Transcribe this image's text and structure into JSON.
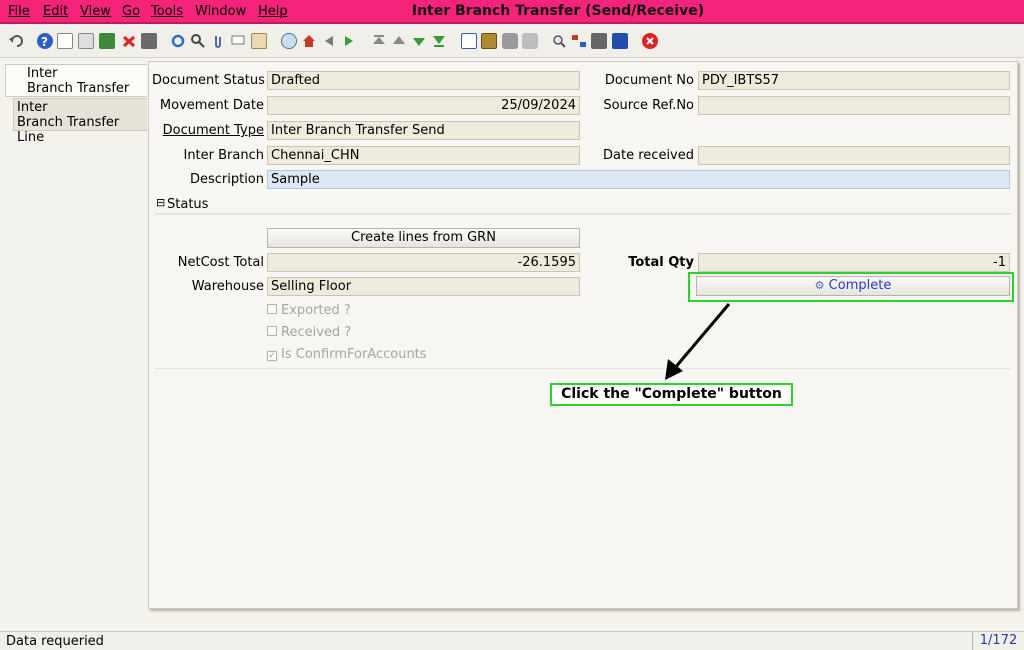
{
  "menu": {
    "file": "File",
    "edit": "Edit",
    "view": "View",
    "go": "Go",
    "tools": "Tools",
    "window": "Window",
    "help": "Help"
  },
  "window_title": "Inter Branch Transfer (Send/Receive)",
  "tabs": {
    "tab1_line1": "Inter",
    "tab1_line2": "Branch Transfer",
    "tab2_line1": "Inter",
    "tab2_line2": "Branch Transfer Line"
  },
  "form": {
    "document_status_label": "Document Status",
    "document_status": "Drafted",
    "document_no_label": "Document No",
    "document_no": "PDY_IBTS57",
    "movement_date_label": "Movement Date",
    "movement_date": "25/09/2024",
    "source_ref_label": "Source Ref.No",
    "source_ref": "",
    "document_type_label": "Document Type",
    "document_type": "Inter Branch Transfer Send",
    "inter_branch_label": "Inter Branch",
    "inter_branch": "Chennai_CHN",
    "date_received_label": "Date received",
    "date_received": "",
    "description_label": "Description",
    "description": "Sample"
  },
  "status_section": {
    "toggle": "⊟",
    "title": "Status",
    "create_lines_button": "Create lines from GRN",
    "netcost_total_label": "NetCost Total",
    "netcost_total": "-26.1595",
    "total_qty_label": "Total Qty",
    "total_qty": "-1",
    "warehouse_label": "Warehouse",
    "warehouse": "Selling Floor",
    "complete_button": "Complete",
    "exported_label": "Exported ?",
    "received_label": "Received ?",
    "confirm_label": "Is ConfirmForAccounts"
  },
  "annotation": "Click the \"Complete\" button",
  "statusbar": {
    "message": "Data requeried",
    "page": "1/172"
  },
  "colors": {
    "title_bar": "#f5237a",
    "highlight": "#2bd22b"
  }
}
